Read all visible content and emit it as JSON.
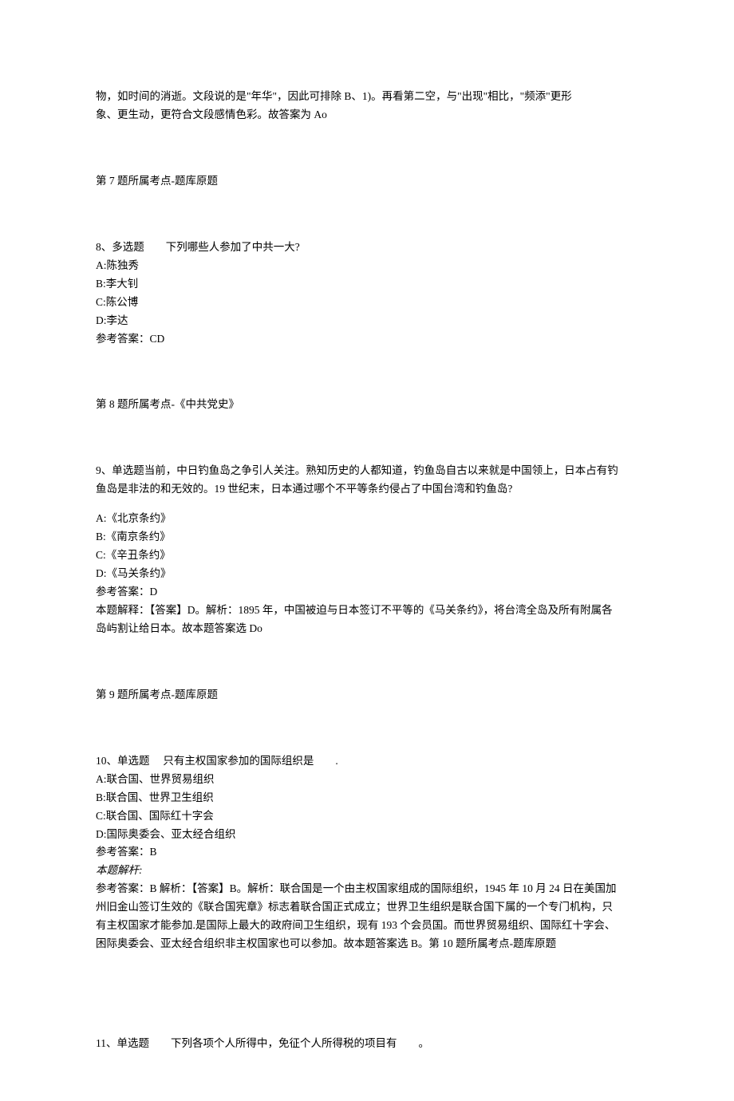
{
  "pre_explanation_line1": "物，如时间的消逝。文段说的是\"年华\"，因此可排除 B、1)。再看第二空，与\"出现\"相比，\"频添\"更形",
  "pre_explanation_line2": "象、更生动，更符合文段感情色彩。故答案为 Ao",
  "item7_topic": "第 7 题所属考点-题库原题",
  "q8_header": "8、多选题  下列哪些人参加了中共一大?",
  "q8_a": "A:陈独秀",
  "q8_b": "B:李大钊",
  "q8_c": "C:陈公博",
  "q8_d": "D:李达",
  "q8_answer": "参考答案：CD",
  "item8_topic": "第 8 题所属考点-《中共党史》",
  "q9_header": "9、单选题当前，中日钓鱼岛之争引人关注。熟知历史的人都知道，钓鱼岛自古以来就是中国领上，日本占有钓",
  "q9_header_line2": "鱼岛是非法的和无效的。19 世纪末，日本通过哪个不平等条约侵占了中国台湾和钓鱼岛?",
  "q9_a": "A:《北京条约》",
  "q9_b": "B:《南京条约》",
  "q9_c": "C:《辛丑条约》",
  "q9_d": "D:《马关条约》",
  "q9_answer": "参考答案：D",
  "q9_expl_line1": "本题解释：【答案】D。解析：1895 年，中国被迫与日本签订不平等的《马关条约》，将台湾全岛及所有附属各",
  "q9_expl_line2": "岛屿割让给日本。故本题答案选 Do",
  "item9_topic": "第 9 题所属考点-题库原题",
  "q10_header": "10、单选题  只有主权国家参加的国际组织是  .",
  "q10_a": "A:联合国、世界贸易组织",
  "q10_b": "B:联合国、世界卫生组织",
  "q10_c": "C:联合国、国际红十字会",
  "q10_d": "D:国际奥委会、亚太经合组织",
  "q10_answer": "参考答案：B",
  "q10_expl_label": "本题解杆:",
  "q10_expl_line1": "参考答案：B 解析：【答案】B。解析：联合国是一个由主权国家组成的国际组织，1945 年 10 月 24 日在美国加",
  "q10_expl_line2": "州旧金山签订生效的《联合国宪章》标志着联合国正式成立；世界卫生组织是联合国下属的一个专门机构，只",
  "q10_expl_line3": "有主权国家才能参加.是国际上最大的政府间卫生组织，现有 193 个会员国。而世界贸易组织、国际红十字会、",
  "q10_expl_line4": "困际奥委会、亚太经合组织非主权国家也可以参加。故本题答案选 B。第 10 题所属考点-题库原题",
  "q11_header": "11、单选题  下列各项个人所得中，免征个人所得税的项目有  。"
}
